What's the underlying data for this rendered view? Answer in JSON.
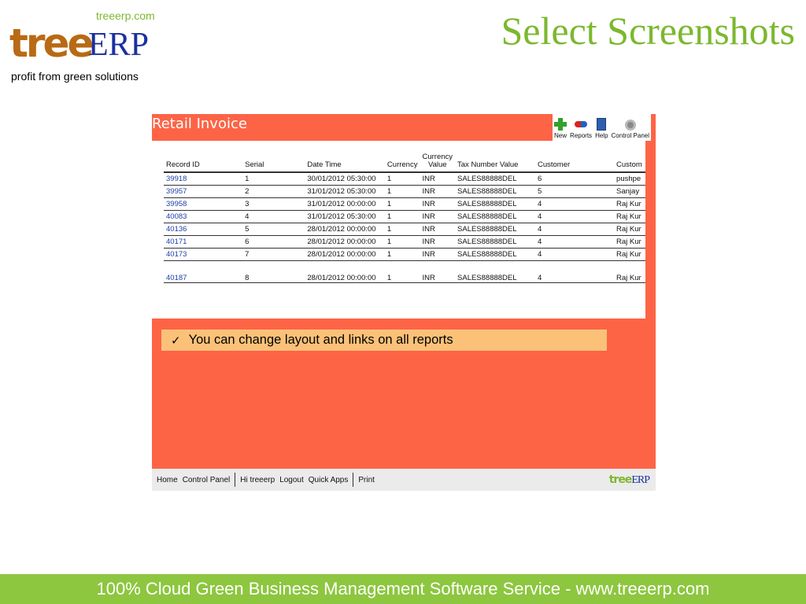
{
  "logo": {
    "url": "treeerp.com",
    "mark_tree": "tree",
    "mark_erp": "ERP",
    "tagline": "profit from green solutions"
  },
  "slide_title": "Select Screenshots",
  "app": {
    "title": "Retail Invoice",
    "toolbar": [
      {
        "label": "New",
        "icon": "plus-icon"
      },
      {
        "label": "Reports",
        "icon": "reports-icon"
      },
      {
        "label": "Help",
        "icon": "help-book-icon"
      },
      {
        "label": "Control Panel",
        "icon": "gear-icon"
      }
    ],
    "table": {
      "headers": [
        "Record ID",
        "Serial",
        "Date Time",
        "Currency",
        "Currency Value",
        "Tax Number Value",
        "Customer",
        "Custom"
      ],
      "currency_value_header": {
        "line1": "Currency",
        "line2": "Value"
      },
      "rows": [
        [
          "39918",
          "1",
          "30/01/2012 05:30:00",
          "1",
          "INR",
          "SALES88888DEL",
          "6",
          "pushpe"
        ],
        [
          "39957",
          "2",
          "31/01/2012 05:30:00",
          "1",
          "INR",
          "SALES88888DEL",
          "5",
          "Sanjay"
        ],
        [
          "39958",
          "3",
          "31/01/2012 00:00:00",
          "1",
          "INR",
          "SALES88888DEL",
          "4",
          "Raj Kur"
        ],
        [
          "40083",
          "4",
          "31/01/2012 05:30:00",
          "1",
          "INR",
          "SALES88888DEL",
          "4",
          "Raj Kur"
        ],
        [
          "40136",
          "5",
          "28/01/2012 00:00:00",
          "1",
          "INR",
          "SALES88888DEL",
          "4",
          "Raj Kur"
        ],
        [
          "40171",
          "6",
          "28/01/2012 00:00:00",
          "1",
          "INR",
          "SALES88888DEL",
          "4",
          "Raj Kur"
        ],
        [
          "40173",
          "7",
          "28/01/2012 00:00:00",
          "1",
          "INR",
          "SALES88888DEL",
          "4",
          "Raj Kur"
        ],
        [
          "40187",
          "8",
          "28/01/2012 00:00:00",
          "1",
          "INR",
          "SALES88888DEL",
          "4",
          "Raj Kur"
        ]
      ]
    },
    "scroll": {
      "left": "‹",
      "right": "›"
    },
    "note": {
      "check": "✓",
      "text": "You can change layout and links on all reports"
    },
    "footer": {
      "home": "Home",
      "control_panel": "Control Panel",
      "greeting": "Hi treeerp",
      "logout": "Logout",
      "quick_apps": "Quick Apps",
      "print": "Print",
      "mini_logo_tree": "tree",
      "mini_logo_erp": "ERP"
    }
  },
  "slide_footer": "100% Cloud Green Business Management Software Service - www.treeerp.com",
  "colors": {
    "brand_green": "#7cb82f",
    "brand_brown": "#b86a14",
    "brand_blue": "#1b2f9e",
    "app_background": "#fd6446",
    "note_background": "#fbc178",
    "footer_green": "#8dc63f"
  }
}
